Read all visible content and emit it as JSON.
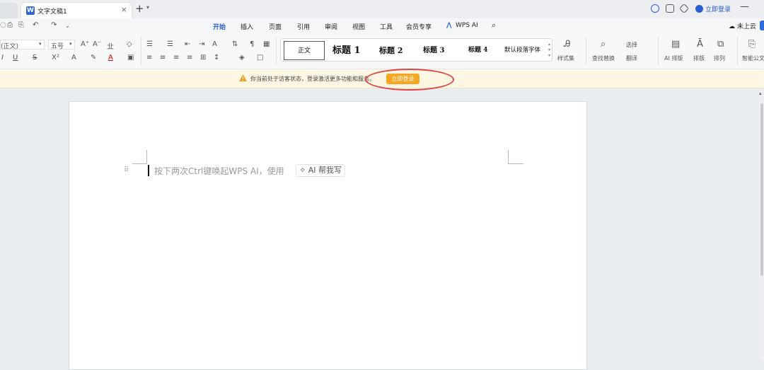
{
  "titlebar": {
    "doc_tab_icon": "W",
    "doc_tab_title": "文字文稿1",
    "close_glyph": "×",
    "new_tab_glyph": "+",
    "login_label": "立即登录",
    "minimize_glyph": "—"
  },
  "menu": {
    "items": [
      "开始",
      "插入",
      "页面",
      "引用",
      "审阅",
      "视图",
      "工具",
      "会员专享",
      "WPS AI"
    ],
    "active_index": 0,
    "cloud_label": "未上云",
    "brand_color": "#2b5fd1"
  },
  "ribbon": {
    "font_name": "(正文)",
    "font_size": "五号",
    "styles": [
      "正文",
      "标题 1",
      "标题 2",
      "标题 3",
      "标题 4",
      "默认段落字体"
    ],
    "style_set_label": "样式集",
    "find_replace_label": "查找替换",
    "select_label": "选择",
    "translate_label": "翻译",
    "ai_layout_label": "AI 排版",
    "layout_label": "排版",
    "arrange_label": "排列",
    "smart_doc_label": "智能公文"
  },
  "notice": {
    "message": "你当前处于访客状态，登录激活更多功能和服务。",
    "button_label": "立即登录",
    "button_color": "#f5a623",
    "highlight_color": "#e04545"
  },
  "document": {
    "placeholder": "按下两次Ctrl键唤起WPS AI，使用",
    "ai_chip_label": "AI 帮我写"
  }
}
